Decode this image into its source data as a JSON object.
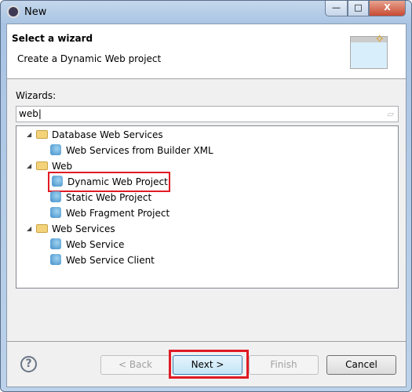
{
  "window": {
    "title": "New",
    "minimize": "—",
    "maximize": "□",
    "close": "X"
  },
  "header": {
    "title": "Select a wizard",
    "description": "Create a Dynamic Web project"
  },
  "wizards_label": "Wizards:",
  "filter": {
    "value": "web",
    "clear_icon": "eraser-icon"
  },
  "tree": [
    {
      "label": "Database Web Services",
      "level": 0,
      "expanded": true,
      "icon": "folder-icon"
    },
    {
      "label": "Web Services from Builder XML",
      "level": 1,
      "icon": "web-service-icon"
    },
    {
      "label": "Web",
      "level": 0,
      "expanded": true,
      "icon": "folder-icon"
    },
    {
      "label": "Dynamic Web Project",
      "level": 1,
      "icon": "web-project-icon",
      "selected": true
    },
    {
      "label": "Static Web Project",
      "level": 1,
      "icon": "web-project-icon"
    },
    {
      "label": "Web Fragment Project",
      "level": 1,
      "icon": "web-project-icon"
    },
    {
      "label": "Web Services",
      "level": 0,
      "expanded": true,
      "icon": "folder-icon"
    },
    {
      "label": "Web Service",
      "level": 1,
      "icon": "web-service-icon"
    },
    {
      "label": "Web Service Client",
      "level": 1,
      "icon": "web-service-icon"
    }
  ],
  "buttons": {
    "help": "?",
    "back": "< Back",
    "next": "Next >",
    "finish": "Finish",
    "cancel": "Cancel"
  },
  "colors": {
    "highlight": "#e01b24"
  }
}
